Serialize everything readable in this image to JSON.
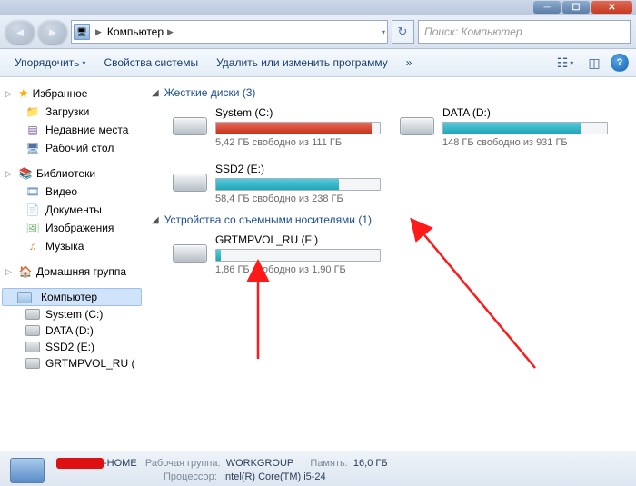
{
  "titlebar": {
    "min": "─",
    "max": "☐",
    "close": "✕"
  },
  "nav": {
    "crumb_root": "Компьютер",
    "refresh_symbol": "↻",
    "search_placeholder": "Поиск: Компьютер"
  },
  "toolbar": {
    "organize": "Упорядочить",
    "properties": "Свойства системы",
    "uninstall": "Удалить или изменить программу",
    "more": "»"
  },
  "sidebar": {
    "favorites": "Избранное",
    "downloads": "Загрузки",
    "recent": "Недавние места",
    "desktop": "Рабочий стол",
    "libraries": "Библиотеки",
    "videos": "Видео",
    "documents": "Документы",
    "pictures": "Изображения",
    "music": "Музыка",
    "homegroup": "Домашняя группа",
    "computer": "Компьютер",
    "drv_c": "System (C:)",
    "drv_d": "DATA (D:)",
    "drv_e": "SSD2 (E:)",
    "drv_f": "GRTMPVOL_RU ("
  },
  "content": {
    "cat_hdd": "Жесткие диски (3)",
    "cat_removable": "Устройства со съемными носителями (1)",
    "drives": {
      "c": {
        "name": "System (C:)",
        "free": "5,42 ГБ свободно из 111 ГБ",
        "fill_pct": 95,
        "color": "red"
      },
      "d": {
        "name": "DATA (D:)",
        "free": "148 ГБ свободно из 931 ГБ",
        "fill_pct": 84,
        "color": "teal"
      },
      "e": {
        "name": "SSD2 (E:)",
        "free": "58,4 ГБ свободно из 238 ГБ",
        "fill_pct": 75,
        "color": "teal"
      },
      "f": {
        "name": "GRTMPVOL_RU (F:)",
        "free": "1,86 ГБ свободно из 1,90 ГБ",
        "fill_pct": 3,
        "color": "teal"
      }
    }
  },
  "status": {
    "host_suffix": "-HOME",
    "workgroup_label": "Рабочая группа:",
    "workgroup": "WORKGROUP",
    "memory_label": "Память:",
    "memory": "16,0 ГБ",
    "cpu_label": "Процессор:",
    "cpu": "Intel(R) Core(TM) i5-24"
  }
}
